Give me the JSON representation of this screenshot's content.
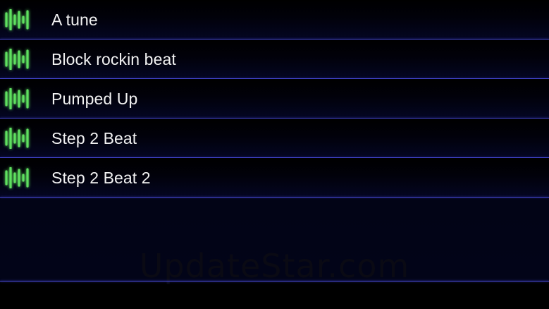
{
  "tracks": [
    {
      "title": "A tune",
      "icon": "sound-wave-icon"
    },
    {
      "title": "Block rockin beat",
      "icon": "sound-wave-icon"
    },
    {
      "title": "Pumped Up",
      "icon": "sound-wave-icon"
    },
    {
      "title": "Step 2 Beat",
      "icon": "sound-wave-icon"
    },
    {
      "title": "Step 2 Beat 2",
      "icon": "sound-wave-icon"
    }
  ],
  "watermark": "UpdateStar.com",
  "colors": {
    "row_divider": "#4648d8",
    "icon_green": "#5fe060",
    "label_text": "#f2f2f2",
    "background": "#020416"
  }
}
